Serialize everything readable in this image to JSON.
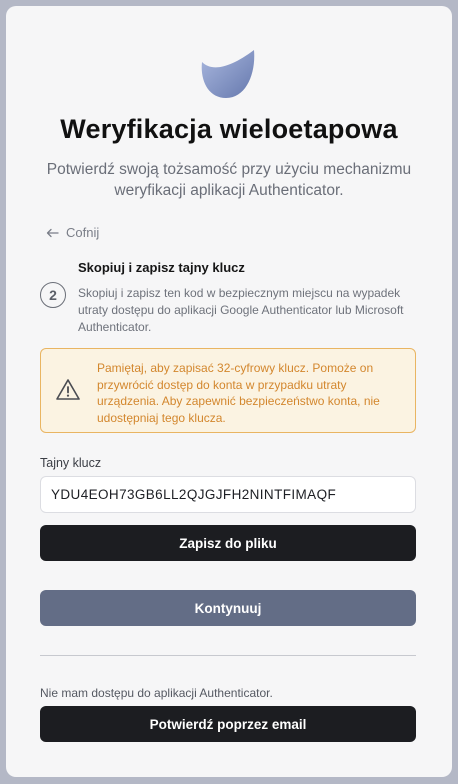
{
  "page": {
    "title": "Weryfikacja wieloetapowa",
    "subtitle": "Potwierdź swoją tożsamość przy użyciu mechanizmu weryfikacji aplikacji Authenticator."
  },
  "nav": {
    "back_label": "Cofnij"
  },
  "step": {
    "number": "2",
    "title": "Skopiuj i zapisz tajny klucz",
    "description": "Skopiuj i zapisz ten kod w bezpiecznym miejscu na wypadek utraty dostępu do aplikacji Google Authenticator lub Microsoft Authenticator."
  },
  "alert": {
    "icon": "warning-triangle-icon",
    "text": "Pamiętaj, aby zapisać 32-cyfrowy klucz. Pomoże on przywrócić dostęp do konta w przypadku utraty urządzenia. Aby zapewnić bezpieczeństwo konta, nie udostępniaj tego klucza."
  },
  "secret": {
    "label": "Tajny klucz",
    "value": "YDU4EOH73GB6LL2QJGJFH2NINTFIMAQF"
  },
  "buttons": {
    "save_label": "Zapisz do pliku",
    "continue_label": "Kontynuuj",
    "email_label": "Potwierdź poprzez email"
  },
  "footer": {
    "no_access_text": "Nie mam dostępu do aplikacji Authenticator."
  },
  "colors": {
    "background": "#b4b8c6",
    "card": "#f6f6f7",
    "dark_button": "#1c1d21",
    "slate_button": "#636d86",
    "alert_border": "#e9b562",
    "alert_text": "#d3872e"
  }
}
